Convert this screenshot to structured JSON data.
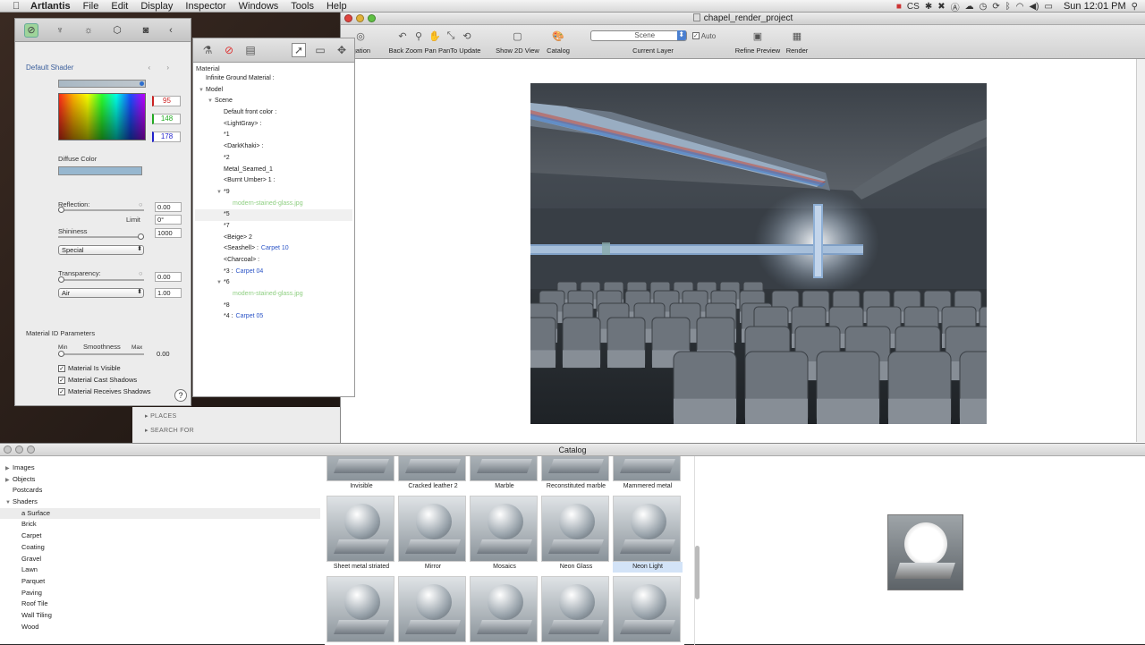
{
  "menubar": {
    "app": "Artlantis",
    "items": [
      "File",
      "Edit",
      "Display",
      "Inspector",
      "Windows",
      "Tools",
      "Help"
    ],
    "status_text": "CS",
    "clock": "Sun 12:01 PM"
  },
  "main_window": {
    "title": "chapel_render_project",
    "toolbar": {
      "navigation_label": "igation",
      "back_group_label": "Back Zoom Pan PanTo Update",
      "show2d_label": "Show 2D View",
      "catalog_label": "Catalog",
      "scene_value": "Scene",
      "auto_label": "Auto",
      "current_layer_label": "Current Layer",
      "refine_preview_label": "Refine Preview",
      "render_label": "Render"
    }
  },
  "inspector": {
    "title": "Default Shader",
    "rgb": {
      "r": "95",
      "g": "148",
      "b": "178"
    },
    "diffuse_label": "Diffuse Color",
    "reflection_label": "Reflection:",
    "reflection_value": "0.00",
    "limit_label": "Limit",
    "limit_value": "0°",
    "shininess_label": "Shininess",
    "shininess_value": "1000",
    "special_popup": "Special",
    "transparency_label": "Transparency:",
    "transparency_value": "0.00",
    "medium_popup": "Air",
    "medium_value": "1.00",
    "material_id_title": "Material ID Parameters",
    "smooth_min": "Min",
    "smooth_label": "Smoothness",
    "smooth_max": "Max",
    "smooth_value": "0.00",
    "checks": [
      {
        "label": "Material Is Visible",
        "checked": true
      },
      {
        "label": "Material Cast Shadows",
        "checked": true
      },
      {
        "label": "Material Receives Shadows",
        "checked": true
      }
    ]
  },
  "material_tree": {
    "header": "Material",
    "rows": [
      {
        "indent": 0,
        "tri": "",
        "text": "Infinite Ground Material :",
        "extra": "",
        "style": ""
      },
      {
        "indent": 0,
        "tri": "▼",
        "text": "Model",
        "extra": "",
        "style": ""
      },
      {
        "indent": 1,
        "tri": "▼",
        "text": "Scene",
        "extra": "",
        "style": ""
      },
      {
        "indent": 2,
        "tri": "",
        "text": "Default front color :",
        "extra": "",
        "style": ""
      },
      {
        "indent": 2,
        "tri": "",
        "text": "<LightGray> :",
        "extra": "",
        "style": ""
      },
      {
        "indent": 2,
        "tri": "",
        "text": "*1",
        "extra": "",
        "style": ""
      },
      {
        "indent": 2,
        "tri": "",
        "text": "<DarkKhaki> :",
        "extra": "",
        "style": ""
      },
      {
        "indent": 2,
        "tri": "",
        "text": "*2",
        "extra": "",
        "style": ""
      },
      {
        "indent": 2,
        "tri": "",
        "text": "Metal_Seamed_1",
        "extra": "",
        "style": ""
      },
      {
        "indent": 2,
        "tri": "",
        "text": "<Burnt Umber> 1 :",
        "extra": "",
        "style": ""
      },
      {
        "indent": 2,
        "tri": "▼",
        "text": "*9",
        "extra": "",
        "style": ""
      },
      {
        "indent": 3,
        "tri": "",
        "text": "modern-stained-glass.jpg",
        "extra": "",
        "style": "green"
      },
      {
        "indent": 2,
        "tri": "",
        "text": "*5",
        "extra": "",
        "style": "sel"
      },
      {
        "indent": 2,
        "tri": "",
        "text": "*7",
        "extra": "",
        "style": ""
      },
      {
        "indent": 2,
        "tri": "",
        "text": "<Beige> 2",
        "extra": "",
        "style": ""
      },
      {
        "indent": 2,
        "tri": "",
        "text": "<Seashell> :",
        "extra": "Carpet 10",
        "style": ""
      },
      {
        "indent": 2,
        "tri": "",
        "text": "<Charcoal> :",
        "extra": "",
        "style": ""
      },
      {
        "indent": 2,
        "tri": "",
        "text": "*3 :",
        "extra": "Carpet 04",
        "style": ""
      },
      {
        "indent": 2,
        "tri": "▼",
        "text": "*6",
        "extra": "",
        "style": ""
      },
      {
        "indent": 3,
        "tri": "",
        "text": "modern-stained-glass.jpg",
        "extra": "",
        "style": "green"
      },
      {
        "indent": 2,
        "tri": "",
        "text": "*8",
        "extra": "",
        "style": ""
      },
      {
        "indent": 2,
        "tri": "",
        "text": "*4 :",
        "extra": "Carpet 05",
        "style": ""
      }
    ]
  },
  "finder": {
    "places": "PLACES",
    "search_for": "SEARCH FOR"
  },
  "catalog": {
    "title": "Catalog",
    "tree": [
      {
        "label": "Images",
        "child": false,
        "tri": "▶",
        "sel": false
      },
      {
        "label": "Objects",
        "child": false,
        "tri": "▶",
        "sel": false
      },
      {
        "label": "Postcards",
        "child": false,
        "tri": "",
        "sel": false
      },
      {
        "label": "Shaders",
        "child": false,
        "tri": "▼",
        "sel": false
      },
      {
        "label": "a Surface",
        "child": true,
        "tri": "",
        "sel": true
      },
      {
        "label": "Brick",
        "child": true,
        "tri": "",
        "sel": false
      },
      {
        "label": "Carpet",
        "child": true,
        "tri": "",
        "sel": false
      },
      {
        "label": "Coating",
        "child": true,
        "tri": "",
        "sel": false
      },
      {
        "label": "Gravel",
        "child": true,
        "tri": "",
        "sel": false
      },
      {
        "label": "Lawn",
        "child": true,
        "tri": "",
        "sel": false
      },
      {
        "label": "Parquet",
        "child": true,
        "tri": "",
        "sel": false
      },
      {
        "label": "Paving",
        "child": true,
        "tri": "",
        "sel": false
      },
      {
        "label": "Roof Tile",
        "child": true,
        "tri": "",
        "sel": false
      },
      {
        "label": "Wall Tiling",
        "child": true,
        "tri": "",
        "sel": false
      },
      {
        "label": "Wood",
        "child": true,
        "tri": "",
        "sel": false
      }
    ],
    "tiles_row1": [
      "Invisible",
      "Cracked leather 2",
      "Marble",
      "Reconstituted marble",
      "Mammered metal"
    ],
    "tiles_row2": [
      "Sheet metal striated",
      "Mirror",
      "Mosaics",
      "Neon Glass",
      "Neon Light"
    ],
    "selected_tile": "Neon Light",
    "row3_tiles": 5
  }
}
